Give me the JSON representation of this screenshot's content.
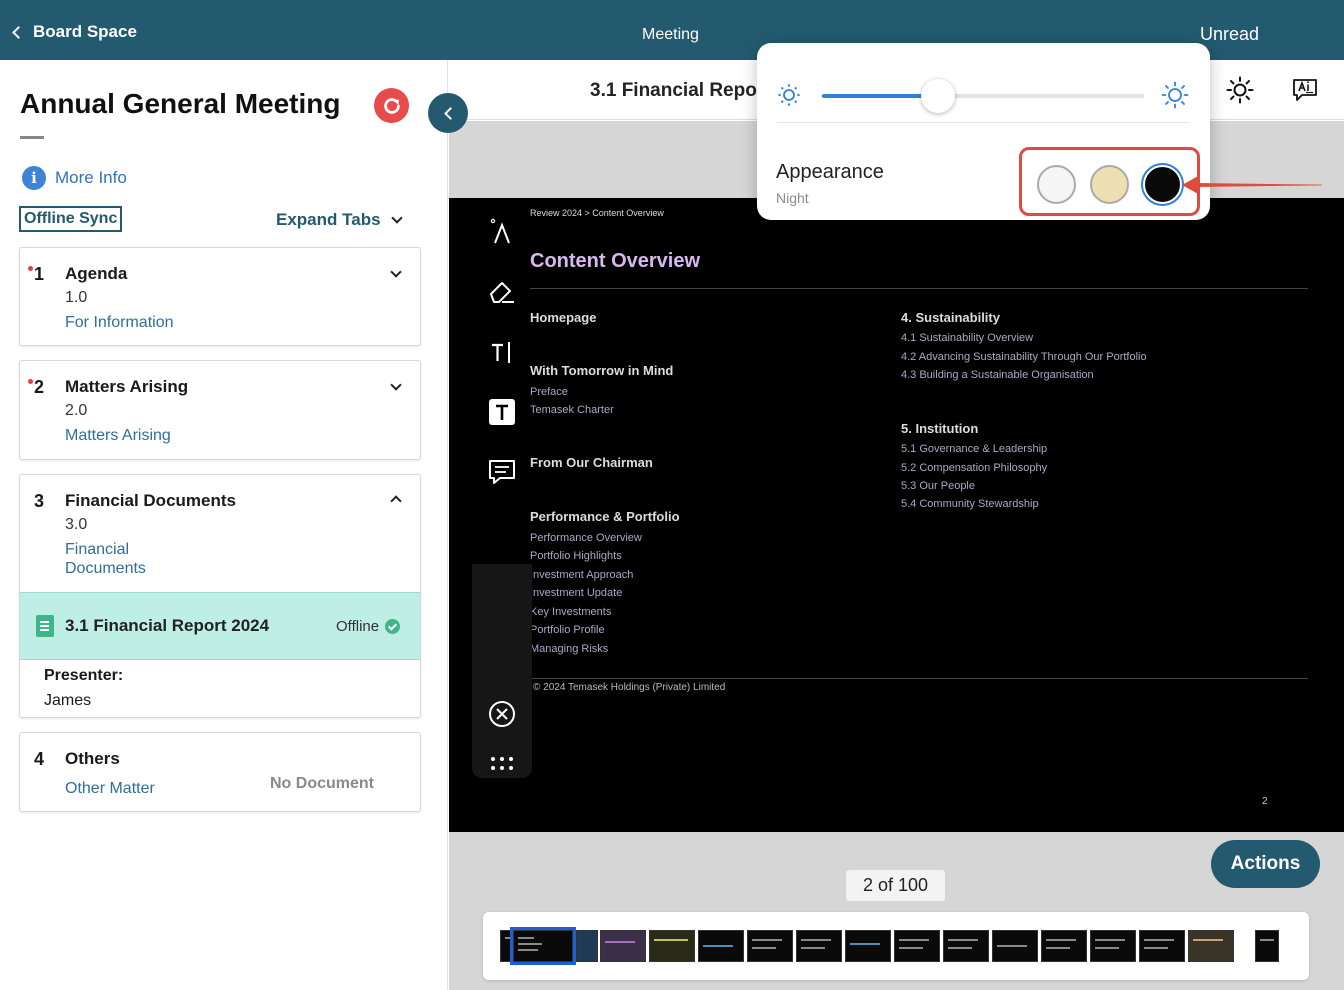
{
  "topbar": {
    "back_label": "Board Space",
    "center_label": "Meeting",
    "right_label": "Unread"
  },
  "meeting": {
    "title": "Annual General Meeting",
    "more_info": "More Info",
    "offline_sync": "Offline Sync",
    "expand_tabs": "Expand Tabs"
  },
  "agenda": [
    {
      "number": "1",
      "title": "Agenda",
      "version": "1.0",
      "purpose": "For Information",
      "unread": true,
      "expanded": false
    },
    {
      "number": "2",
      "title": "Matters Arising",
      "version": "2.0",
      "purpose": "Matters Arising",
      "unread": true,
      "expanded": false
    },
    {
      "number": "3",
      "title": "Financial Documents",
      "version": "3.0",
      "purpose": "Financial Documents",
      "unread": false,
      "expanded": true,
      "sub_item": {
        "title": "3.1 Financial Report 2024",
        "status": "Offline",
        "presenter_label": "Presenter:",
        "presenter": "James"
      }
    },
    {
      "number": "4",
      "title": "Others",
      "purpose": "Other Matter",
      "no_document": "No Document"
    }
  ],
  "document": {
    "title": "3.1 Financial Report 2024",
    "page_indicator": "2 of 100",
    "actions_label": "Actions",
    "page": {
      "breadcrumb": "Review 2024 > Content Overview",
      "heading": "Content Overview",
      "left_sections": [
        {
          "title": "Homepage",
          "items": []
        },
        {
          "title": "With Tomorrow in Mind",
          "items": [
            "Preface",
            "Temasek Charter"
          ]
        },
        {
          "title": "From Our Chairman",
          "items": []
        },
        {
          "title": "Performance & Portfolio",
          "items": [
            "Performance Overview",
            "Portfolio Highlights",
            "Investment Approach",
            "Investment Update",
            "Key Investments",
            "Portfolio Profile",
            "Managing Risks"
          ]
        }
      ],
      "right_sections": [
        {
          "title": "4.  Sustainability",
          "items": [
            "4.1 Sustainability Overview",
            "4.2 Advancing Sustainability Through Our Portfolio",
            "4.3 Building a Sustainable Organisation"
          ]
        },
        {
          "title": "5.  Institution",
          "items": [
            "5.1 Governance & Leadership",
            "5.2 Compensation Philosophy",
            "5.3 Our People",
            "5.4 Community Stewardship"
          ]
        }
      ],
      "copyright": "© 2024 Temasek Holdings (Private) Limited",
      "page_number": "2"
    }
  },
  "appearance": {
    "label": "Appearance",
    "mode": "Night",
    "brightness": 0.36,
    "themes": [
      "light",
      "sepia",
      "night"
    ],
    "selected_theme": "night",
    "colors": {
      "light": "#f5f5f5",
      "sepia": "#eddfb1",
      "night": "#0a0a0a",
      "accent": "#2f7fe0",
      "highlight": "#e04b3f"
    }
  },
  "colors": {
    "brand": "#235a6f",
    "selected_row": "#bfeee5",
    "link": "#2f72c4"
  }
}
